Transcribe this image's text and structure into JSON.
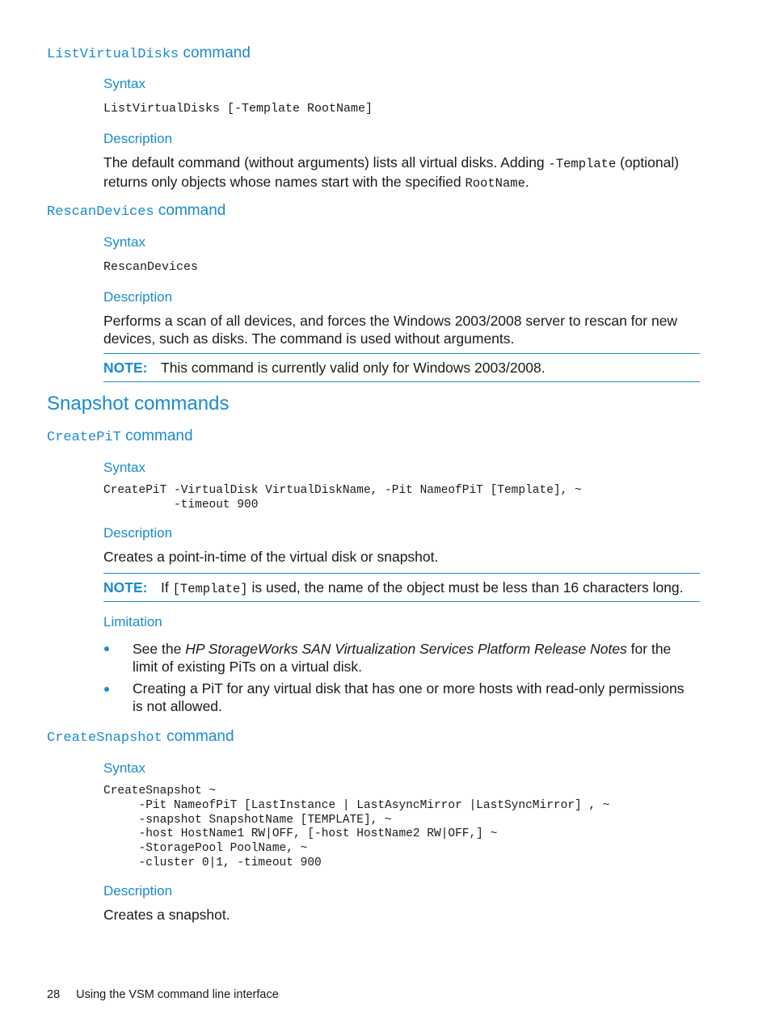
{
  "sections": {
    "list_virtual_disks": {
      "cmd": "ListVirtualDisks",
      "cmd_suffix": " command",
      "syntax_label": "Syntax",
      "syntax": "ListVirtualDisks [-Template RootName]",
      "description_label": "Description",
      "description_1": "The default command (without arguments) lists all virtual disks. Adding ",
      "description_code1": "-Template",
      "description_2": " (optional) returns only objects whose names start with the specified ",
      "description_code2": "RootName",
      "description_3": "."
    },
    "rescan_devices": {
      "cmd": "RescanDevices",
      "cmd_suffix": " command",
      "syntax_label": "Syntax",
      "syntax": "RescanDevices",
      "description_label": "Description",
      "description": "Performs a scan of all devices, and forces the Windows 2003/2008 server to rescan for new devices, such as disks. The command is used without arguments.",
      "note_label": "NOTE:",
      "note_text": "This command is currently valid only for Windows 2003/2008."
    },
    "snapshot_commands": {
      "title": "Snapshot commands"
    },
    "create_pit": {
      "cmd": "CreatePiT",
      "cmd_suffix": " command",
      "syntax_label": "Syntax",
      "syntax": "CreatePiT -VirtualDisk VirtualDiskName, -Pit NameofPiT [Template], ~\n          -timeout 900",
      "description_label": "Description",
      "description": "Creates a point-in-time of the virtual disk or snapshot.",
      "note_label": "NOTE:",
      "note_1": "If ",
      "note_code": "[Template]",
      "note_2": " is used, the name of the object must be less than 16 characters long.",
      "limitation_label": "Limitation",
      "limitations": [
        {
          "pre": "See the ",
          "italic": "HP StorageWorks SAN Virtualization Services Platform Release Notes",
          "post": " for the limit of existing PiTs on a virtual disk."
        },
        {
          "text": "Creating a PiT for any virtual disk that has one or more hosts with read-only permissions is not allowed."
        }
      ]
    },
    "create_snapshot": {
      "cmd": "CreateSnapshot",
      "cmd_suffix": " command",
      "syntax_label": "Syntax",
      "syntax": "CreateSnapshot ~\n     -Pit NameofPiT [LastInstance | LastAsyncMirror |LastSyncMirror] , ~\n     -snapshot SnapshotName [TEMPLATE], ~\n     -host HostName1 RW|OFF, [-host HostName2 RW|OFF,] ~\n     -StoragePool PoolName, ~\n     -cluster 0|1, -timeout 900",
      "description_label": "Description",
      "description": "Creates a snapshot."
    }
  },
  "footer": {
    "page_number": "28",
    "chapter": "Using the VSM command line interface"
  }
}
